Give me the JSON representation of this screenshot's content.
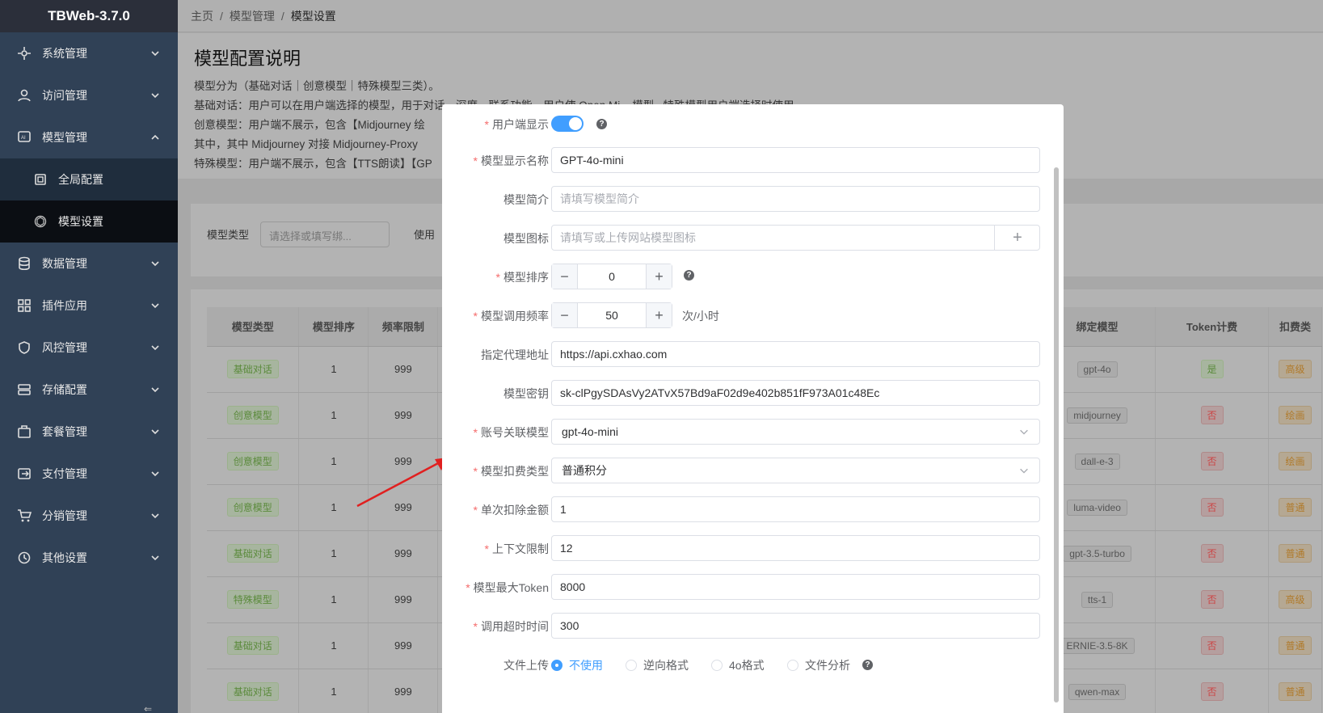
{
  "app": {
    "title": "TBWeb-3.7.0"
  },
  "sidebar": {
    "items": [
      {
        "label": "系统管理",
        "icon": "system-icon"
      },
      {
        "label": "访问管理",
        "icon": "user-icon"
      },
      {
        "label": "模型管理",
        "icon": "ai-model-icon",
        "expanded": true
      },
      {
        "label": "全局配置",
        "icon": "config-icon",
        "sub": true
      },
      {
        "label": "模型设置",
        "icon": "openai-icon",
        "sub": true,
        "active": true
      },
      {
        "label": "数据管理",
        "icon": "database-icon"
      },
      {
        "label": "插件应用",
        "icon": "apps-icon"
      },
      {
        "label": "风控管理",
        "icon": "shield-icon"
      },
      {
        "label": "存储配置",
        "icon": "storage-icon"
      },
      {
        "label": "套餐管理",
        "icon": "package-icon"
      },
      {
        "label": "支付管理",
        "icon": "payment-icon"
      },
      {
        "label": "分销管理",
        "icon": "cart-icon"
      },
      {
        "label": "其他设置",
        "icon": "history-icon"
      }
    ]
  },
  "breadcrumb": [
    "主页",
    "模型管理",
    "模型设置"
  ],
  "intro": {
    "title": "模型配置说明",
    "lines": [
      "模型分为（基础对话｜创意模型｜特殊模型三类）。",
      "基础对话：用户可以在用户端选择的模型，用于对话、深度、联系功能、用户使 Open Mi... 模型...特殊模型用户端选择时使用。",
      "创意模型：用户端不展示，包含【Midjourney 绘",
      "其中，其中 Midjourney 对接 Midjourney-Proxy",
      "特殊模型：用户端不展示，包含【TTS朗读】【GP"
    ]
  },
  "filter": {
    "type_label": "模型类型",
    "type_placeholder": "请选择或填写绑...",
    "usage_label": "使用"
  },
  "table": {
    "headers_left": [
      "模型类型",
      "模型排序",
      "频率限制"
    ],
    "headers_right": [
      "绑定模型",
      "Token计费",
      "扣费类"
    ],
    "rows": [
      {
        "type": "基础对话",
        "sort": "1",
        "freq": "999",
        "model": "gpt-4o",
        "token": "是",
        "fee": "高级"
      },
      {
        "type": "创意模型",
        "sort": "1",
        "freq": "999",
        "model": "midjourney",
        "token": "否",
        "fee": "绘画"
      },
      {
        "type": "创意模型",
        "sort": "1",
        "freq": "999",
        "model": "dall-e-3",
        "token": "否",
        "fee": "绘画"
      },
      {
        "type": "创意模型",
        "sort": "1",
        "freq": "999",
        "model": "luma-video",
        "token": "否",
        "fee": "普通"
      },
      {
        "type": "基础对话",
        "sort": "1",
        "freq": "999",
        "model": "gpt-3.5-turbo",
        "token": "否",
        "fee": "普通"
      },
      {
        "type": "特殊模型",
        "sort": "1",
        "freq": "999",
        "model": "tts-1",
        "token": "否",
        "fee": "高级"
      },
      {
        "type": "基础对话",
        "sort": "1",
        "freq": "999",
        "model": "ERNIE-3.5-8K",
        "token": "否",
        "fee": "普通"
      },
      {
        "type": "基础对话",
        "sort": "1",
        "freq": "999",
        "model": "qwen-max",
        "token": "否",
        "fee": "普通"
      }
    ]
  },
  "form": {
    "show_client": {
      "label": "用户端显示",
      "on": true
    },
    "display_name": {
      "label": "模型显示名称",
      "value": "GPT-4o-mini"
    },
    "intro": {
      "label": "模型简介",
      "placeholder": "请填写模型简介"
    },
    "icon": {
      "label": "模型图标",
      "placeholder": "请填写或上传网站模型图标",
      "upload": "+"
    },
    "sort": {
      "label": "模型排序",
      "value": "0",
      "minus": "−",
      "plus": "+"
    },
    "freq": {
      "label": "模型调用频率",
      "value": "50",
      "unit": "次/小时",
      "minus": "−",
      "plus": "+"
    },
    "proxy": {
      "label": "指定代理地址",
      "value": "https://api.cxhao.com"
    },
    "key": {
      "label": "模型密钥",
      "value": "sk-clPgySDAsVy2ATvX57Bd9aF02d9e402b851fF973A01c48Ec"
    },
    "bind_model": {
      "label": "账号关联模型",
      "value": "gpt-4o-mini"
    },
    "fee_type": {
      "label": "模型扣费类型",
      "value": "普通积分"
    },
    "deduct": {
      "label": "单次扣除金额",
      "value": "1"
    },
    "context": {
      "label": "上下文限制",
      "value": "12"
    },
    "max_token": {
      "label": "模型最大Token",
      "value": "8000"
    },
    "timeout": {
      "label": "调用超时时间",
      "value": "300"
    },
    "file_upload": {
      "label": "文件上传",
      "options": [
        "不使用",
        "逆向格式",
        "4o格式",
        "文件分析"
      ],
      "selected": 0
    }
  },
  "colors": {
    "primary": "#409eff",
    "danger": "#f56c6c",
    "sidebar": "#304156",
    "arrow": "#e02020"
  }
}
